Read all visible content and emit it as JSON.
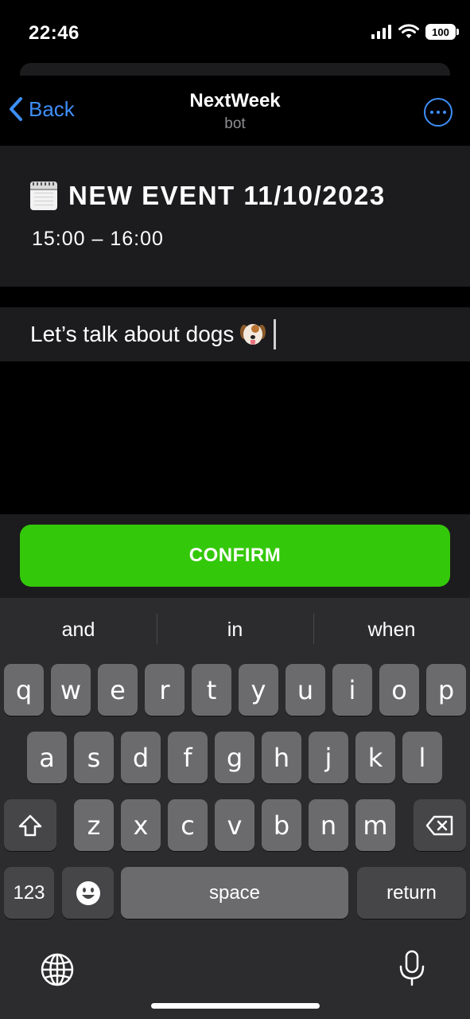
{
  "status_bar": {
    "time": "22:46",
    "battery": "100"
  },
  "header": {
    "back_label": "Back",
    "title": "NextWeek",
    "subtitle": "bot"
  },
  "event": {
    "title": "NEW EVENT 11/10/2023",
    "time": "15:00 – 16:00"
  },
  "message_input": {
    "value": "Let’s talk about dogs"
  },
  "confirm": {
    "label": "CONFIRM"
  },
  "keyboard": {
    "suggestions": [
      "and",
      "in",
      "when"
    ],
    "row1": [
      "q",
      "w",
      "e",
      "r",
      "t",
      "y",
      "u",
      "i",
      "o",
      "p"
    ],
    "row2": [
      "a",
      "s",
      "d",
      "f",
      "g",
      "h",
      "j",
      "k",
      "l"
    ],
    "row3": [
      "z",
      "x",
      "c",
      "v",
      "b",
      "n",
      "m"
    ],
    "numbers_label": "123",
    "space_label": "space",
    "return_label": "return"
  },
  "colors": {
    "accent": "#3e8ef7",
    "confirm": "#34c80a"
  }
}
